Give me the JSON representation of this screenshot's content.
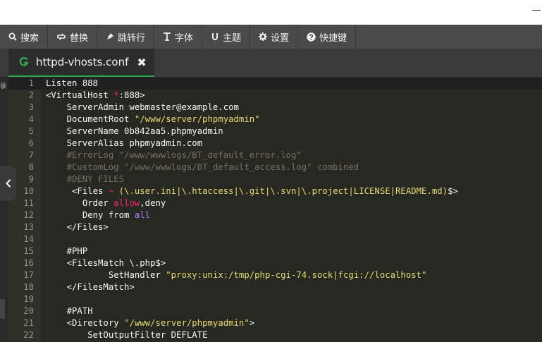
{
  "toolbar": {
    "items": [
      {
        "label": "搜索",
        "icon": "search-icon"
      },
      {
        "label": "替换",
        "icon": "replace-icon"
      },
      {
        "label": "跳转行",
        "icon": "pin-icon"
      },
      {
        "label": "字体",
        "icon": "font-icon"
      },
      {
        "label": "主题",
        "icon": "theme-icon"
      },
      {
        "label": "设置",
        "icon": "gear-icon"
      },
      {
        "label": "快捷键",
        "icon": "help-icon"
      }
    ]
  },
  "tab": {
    "filename": "httpd-vhosts.conf",
    "close_glyph": "✖",
    "accent": "#2ea44f"
  },
  "editor": {
    "lines": [
      {
        "n": "1",
        "text": "Listen 888"
      },
      {
        "n": "2",
        "text": "<VirtualHost *:888>"
      },
      {
        "n": "3",
        "text": "    ServerAdmin webmaster@example.com"
      },
      {
        "n": "4",
        "text": "    DocumentRoot \"/www/server/phpmyadmin\""
      },
      {
        "n": "5",
        "text": "    ServerName 0b842aa5.phpmyadmin"
      },
      {
        "n": "6",
        "text": "    ServerAlias phpmyadmin.com"
      },
      {
        "n": "7",
        "text": "    #ErrorLog \"/www/wwwlogs/BT_default_error.log\""
      },
      {
        "n": "8",
        "text": "    #CustomLog \"/www/wwwlogs/BT_default_access.log\" combined"
      },
      {
        "n": "9",
        "text": "    #DENY FILES"
      },
      {
        "n": "10",
        "text": "     <Files ~ (\\.user.ini|\\.htaccess|\\.git|\\.svn|\\.project|LICENSE|README.md)$>"
      },
      {
        "n": "11",
        "text": "       Order allow,deny"
      },
      {
        "n": "12",
        "text": "       Deny from all"
      },
      {
        "n": "13",
        "text": "    </Files>"
      },
      {
        "n": "14",
        "text": ""
      },
      {
        "n": "15",
        "text": "    #PHP"
      },
      {
        "n": "16",
        "text": "    <FilesMatch \\.php$>"
      },
      {
        "n": "17",
        "text": "            SetHandler \"proxy:unix:/tmp/php-cgi-74.sock|fcgi://localhost\""
      },
      {
        "n": "18",
        "text": "    </FilesMatch>"
      },
      {
        "n": "19",
        "text": ""
      },
      {
        "n": "20",
        "text": "    #PATH"
      },
      {
        "n": "21",
        "text": "    <Directory \"/www/server/phpmyadmin\">"
      },
      {
        "n": "22",
        "text": "        SetOutputFilter DEFLATE"
      }
    ]
  }
}
